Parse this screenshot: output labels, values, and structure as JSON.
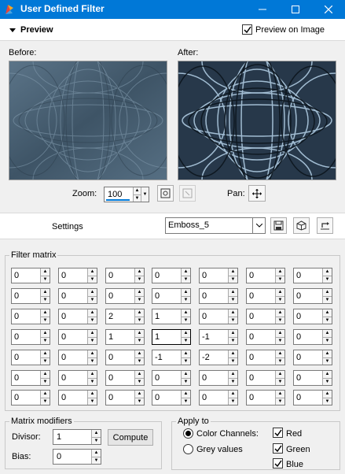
{
  "window": {
    "title": "User Defined Filter",
    "controls": [
      "minimize-icon",
      "maximize-icon",
      "close-icon"
    ]
  },
  "header": {
    "preview_label": "Preview",
    "preview_on_image_label": "Preview on Image",
    "preview_on_image_checked": true
  },
  "preview": {
    "before_label": "Before:",
    "after_label": "After:",
    "zoom_label": "Zoom:",
    "zoom_value": "100",
    "pan_label": "Pan:"
  },
  "settings": {
    "label": "Settings",
    "preset_value": "Emboss_5",
    "buttons": [
      "save-preset-icon",
      "preset-options-icon",
      "reset-icon"
    ]
  },
  "filter_matrix": {
    "title": "Filter matrix",
    "rows": [
      [
        "0",
        "0",
        "0",
        "0",
        "0",
        "0",
        "0"
      ],
      [
        "0",
        "0",
        "0",
        "0",
        "0",
        "0",
        "0"
      ],
      [
        "0",
        "0",
        "2",
        "1",
        "0",
        "0",
        "0"
      ],
      [
        "0",
        "0",
        "1",
        "1",
        "-1",
        "0",
        "0"
      ],
      [
        "0",
        "0",
        "0",
        "-1",
        "-2",
        "0",
        "0"
      ],
      [
        "0",
        "0",
        "0",
        "0",
        "0",
        "0",
        "0"
      ],
      [
        "0",
        "0",
        "0",
        "0",
        "0",
        "0",
        "0"
      ]
    ],
    "focused_cell": [
      3,
      3
    ]
  },
  "matrix_modifiers": {
    "title": "Matrix modifiers",
    "divisor_label": "Divisor:",
    "divisor_value": "1",
    "compute_label": "Compute",
    "bias_label": "Bias:",
    "bias_value": "0"
  },
  "apply_to": {
    "title": "Apply to",
    "color_channels_label": "Color Channels:",
    "color_channels_selected": true,
    "grey_values_label": "Grey values",
    "grey_values_selected": false,
    "red_label": "Red",
    "red_checked": true,
    "green_label": "Green",
    "green_checked": true,
    "blue_label": "Blue",
    "blue_checked": true
  },
  "colors": {
    "titlebar": "#0078d7",
    "preview_before": "#4a6275",
    "preview_after": "#27384a"
  }
}
